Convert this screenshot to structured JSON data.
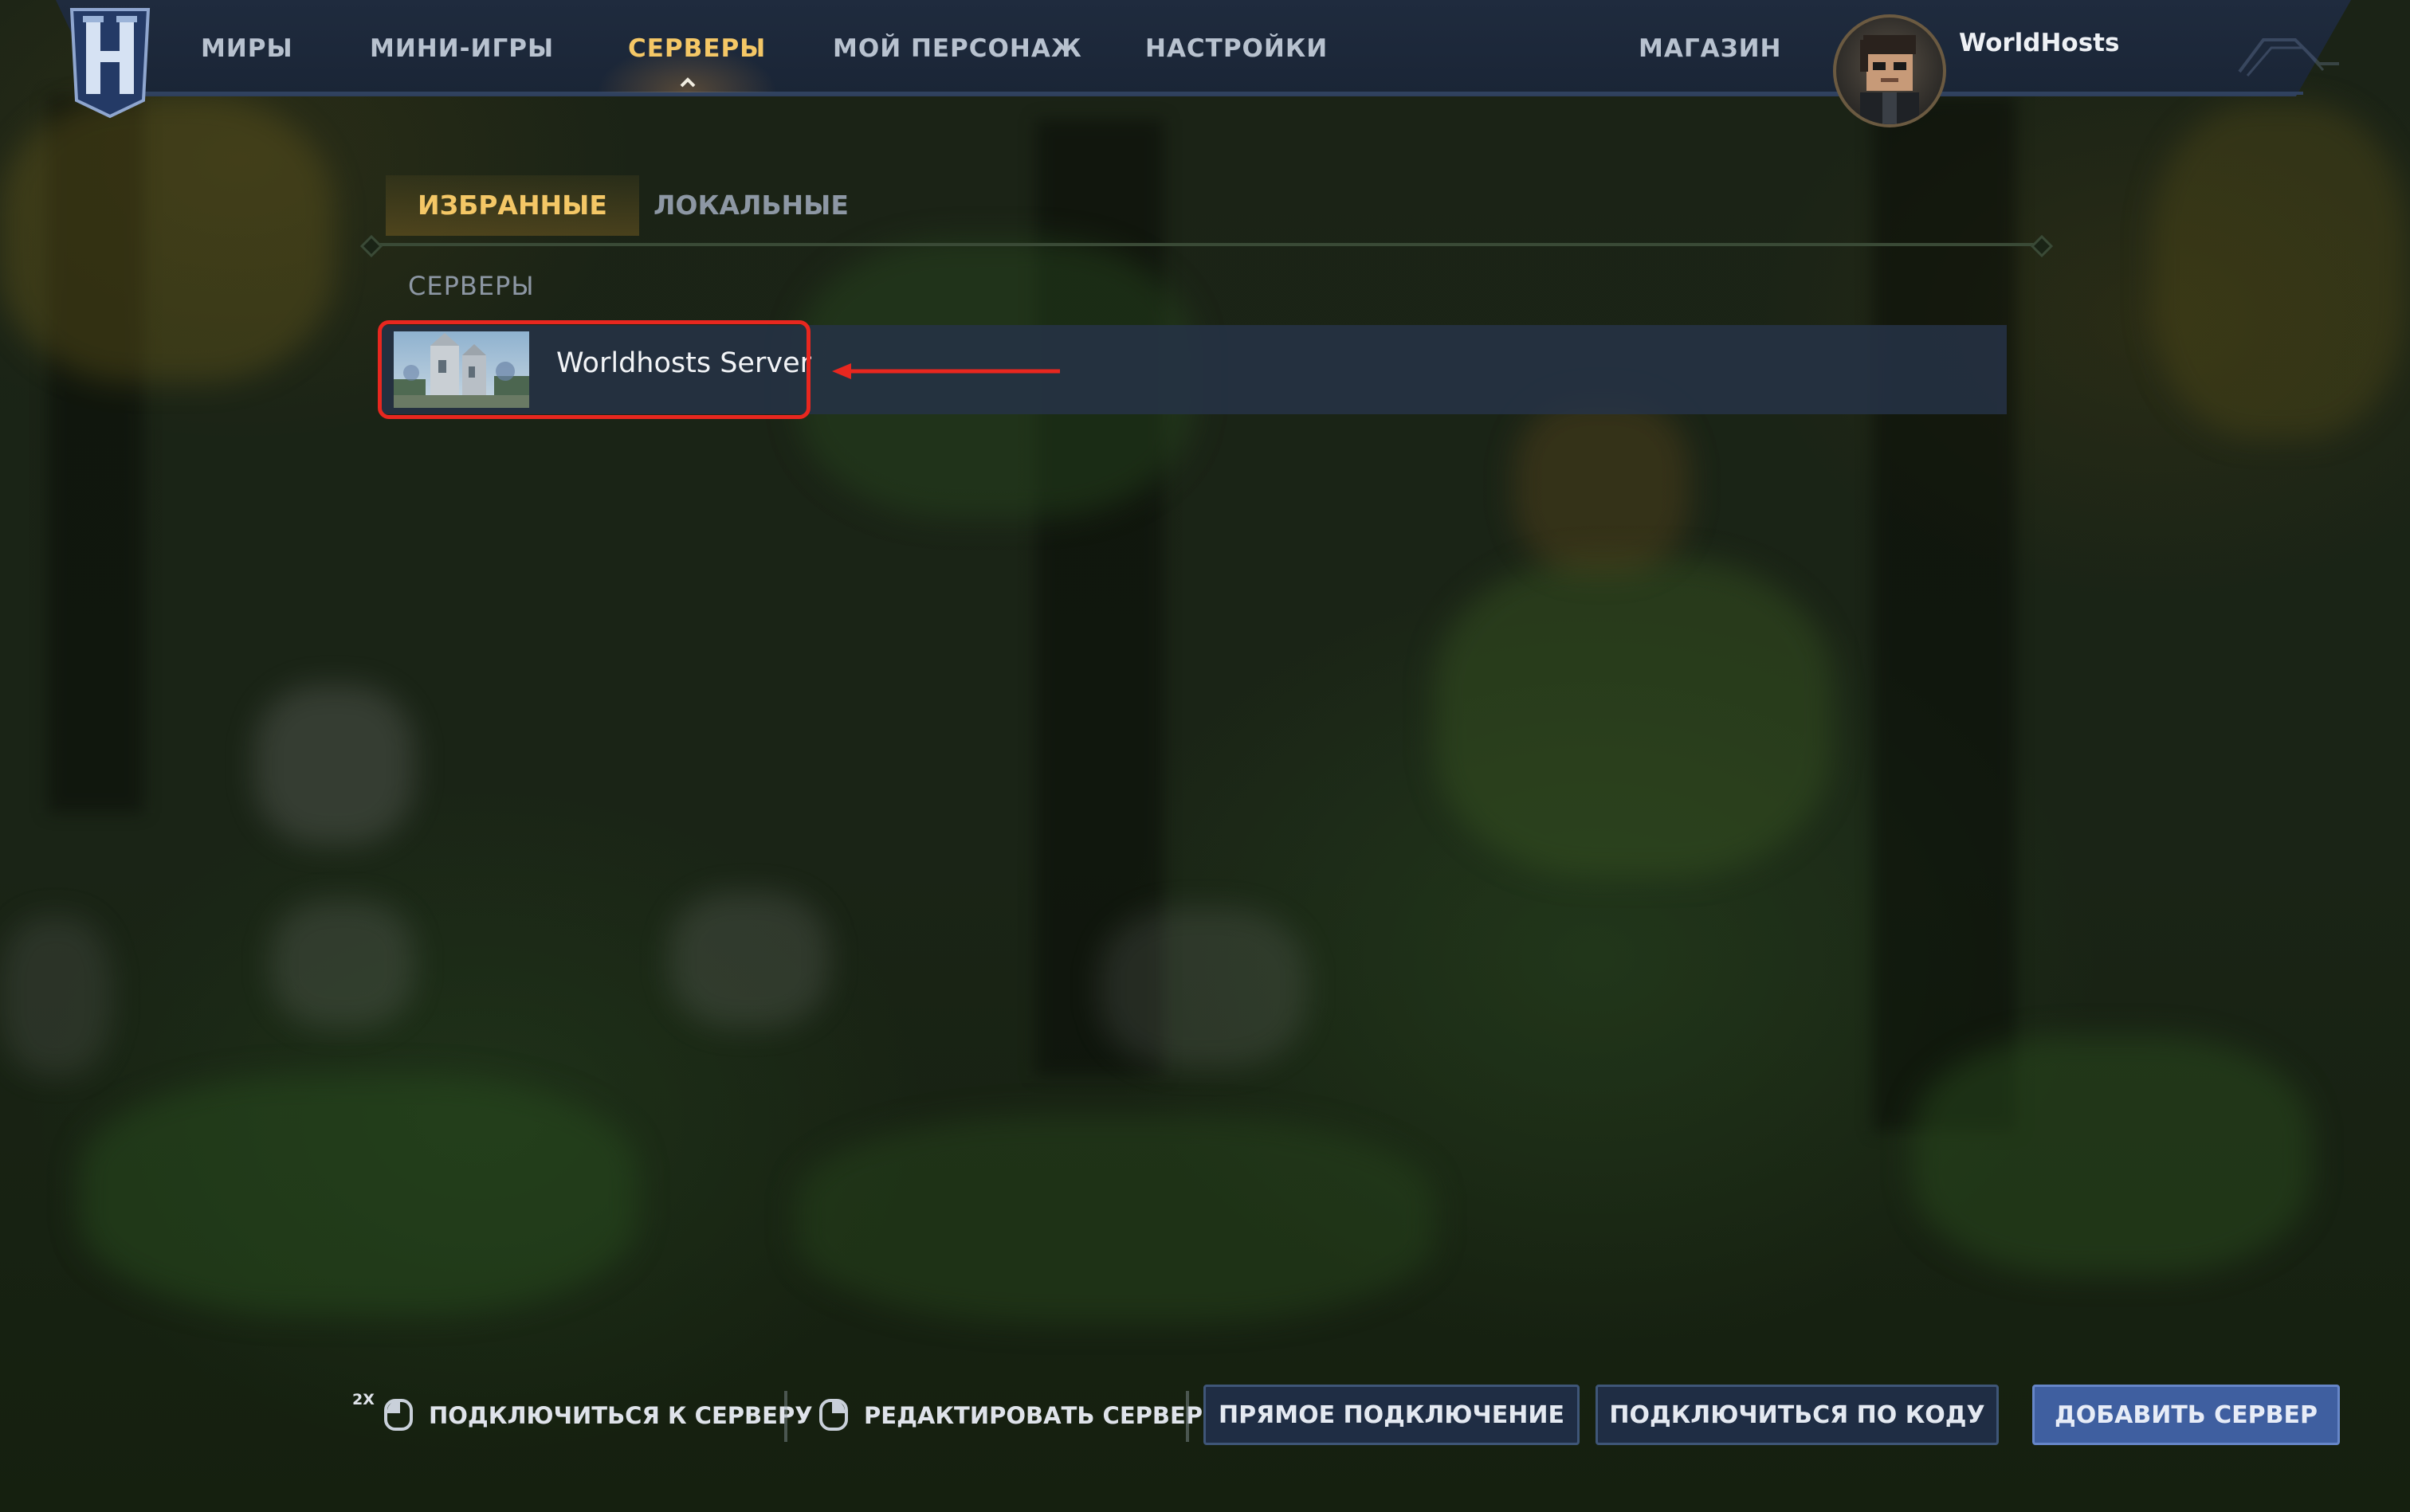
{
  "nav": {
    "items": [
      {
        "label": "МИРЫ",
        "active": false
      },
      {
        "label": "МИНИ-ИГРЫ",
        "active": false
      },
      {
        "label": "СЕРВЕРЫ",
        "active": true
      },
      {
        "label": "МОЙ ПЕРСОНАЖ",
        "active": false
      },
      {
        "label": "НАСТРОЙКИ",
        "active": false
      }
    ],
    "store_label": "МАГАЗИН",
    "username": "WorldHosts",
    "logo_icon": "hytale-h-logo-icon"
  },
  "tabs": [
    {
      "label": "ИЗБРАННЫЕ",
      "active": true
    },
    {
      "label": "ЛОКАЛЬНЫЕ",
      "active": false
    }
  ],
  "servers_section": {
    "label": "СЕРВЕРЫ",
    "items": [
      {
        "name": "Worldhosts Server",
        "selected": true
      }
    ]
  },
  "bottom_bar": {
    "multiplier": "2X",
    "connect_hint": "ПОДКЛЮЧИТЬСЯ К СЕРВЕРУ",
    "edit_hint": "РЕДАКТИРОВАТЬ СЕРВЕР",
    "direct_connect": "ПРЯМОЕ ПОДКЛЮЧЕНИЕ",
    "connect_by_code": "ПОДКЛЮЧИТЬСЯ ПО КОДУ",
    "add_server": "ДОБАВИТЬ СЕРВЕР"
  },
  "colors": {
    "accent_gold": "#f4c766",
    "annotation_red": "#e8271f",
    "primary_button": "#3f5fa0",
    "nav_background": "#1f2b3e"
  }
}
